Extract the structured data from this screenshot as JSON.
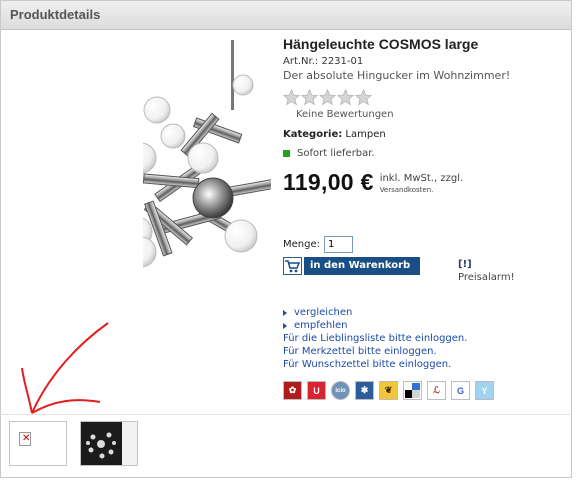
{
  "panel": {
    "title": "Produktdetails"
  },
  "product": {
    "title": "Hängeleuchte COSMOS large",
    "article_number": "Art.Nr.: 2231-01",
    "tagline": "Der absolute Hingucker im Wohnzimmer!",
    "rating": {
      "stars_filled": 0,
      "stars_total": 5,
      "reviews_text": "Keine Bewertungen"
    },
    "category_label": "Kategorie:",
    "category_value": "Lampen",
    "availability": "Sofort lieferbar.",
    "price": "119,00",
    "currency": "€",
    "tax_note": "inkl. MwSt., zzgl.",
    "shipping_note": "Versandkosten."
  },
  "quantity": {
    "label": "Menge:",
    "value": "1"
  },
  "cart_button": {
    "label": "in den Warenkorb"
  },
  "price_alarm": {
    "icon": "[!]",
    "label": "Preisalarm!"
  },
  "links": {
    "compare": "vergleichen",
    "recommend": "empfehlen",
    "wishlist_fav": "Für die Lieblingsliste bitte einloggen.",
    "notepad": "Für Merkzettel bitte einloggen.",
    "wishlist": "Für Wunschzettel bitte einloggen."
  },
  "social_bookmarks": [
    {
      "name": "mister-wong-icon",
      "bg": "#b01c1c",
      "fg": "#ffffff",
      "glyph": "✿"
    },
    {
      "name": "webnews-icon",
      "bg": "#d9232e",
      "fg": "#ffffff",
      "glyph": "U"
    },
    {
      "name": "icio-icon",
      "bg": "#6f93b8",
      "fg": "#ffffff",
      "glyph": "icio"
    },
    {
      "name": "yigg-icon",
      "bg": "#2a5d9a",
      "fg": "#ffffff",
      "glyph": "✱"
    },
    {
      "name": "oneview-icon",
      "bg": "#f3c63a",
      "fg": "#3b2b0a",
      "glyph": "❦"
    },
    {
      "name": "delicious-icon",
      "bg": "#ffffff",
      "fg": "#000000",
      "glyph": ""
    },
    {
      "name": "linkarena-icon",
      "bg": "#ffffff",
      "fg": "#c0392b",
      "glyph": "ℒ"
    },
    {
      "name": "google-icon",
      "bg": "#ffffff",
      "fg": "#3b62c6",
      "glyph": "G"
    },
    {
      "name": "yahoo-icon",
      "bg": "#9fd3ef",
      "fg": "#ffffff",
      "glyph": "Y"
    }
  ],
  "colors": {
    "link": "#1e4aa8",
    "cart_button": "#1a4f86",
    "annotation_arrow": "#e02020",
    "availability": "#21a321"
  }
}
